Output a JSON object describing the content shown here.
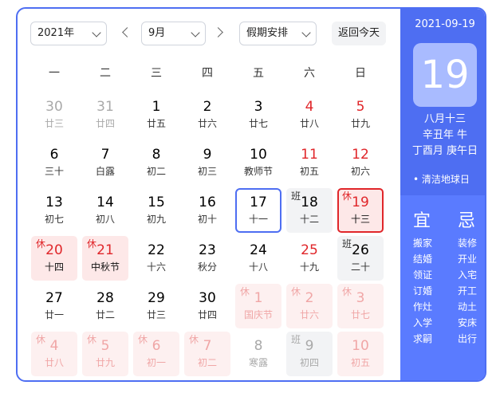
{
  "toolbar": {
    "year": "2021年",
    "month": "9月",
    "holiday_select": "假期安排",
    "today_button": "返回今天"
  },
  "weekdays": [
    "一",
    "二",
    "三",
    "四",
    "五",
    "六",
    "日"
  ],
  "days": [
    {
      "num": "30",
      "lunar": "廿三",
      "type": "other"
    },
    {
      "num": "31",
      "lunar": "廿四",
      "type": "other"
    },
    {
      "num": "1",
      "lunar": "廿五"
    },
    {
      "num": "2",
      "lunar": "廿六"
    },
    {
      "num": "3",
      "lunar": "廿七"
    },
    {
      "num": "4",
      "lunar": "廿八",
      "type": "weekend"
    },
    {
      "num": "5",
      "lunar": "廿九",
      "type": "weekend"
    },
    {
      "num": "6",
      "lunar": "三十"
    },
    {
      "num": "7",
      "lunar": "白露"
    },
    {
      "num": "8",
      "lunar": "初二"
    },
    {
      "num": "9",
      "lunar": "初三"
    },
    {
      "num": "10",
      "lunar": "教师节"
    },
    {
      "num": "11",
      "lunar": "初五",
      "type": "weekend"
    },
    {
      "num": "12",
      "lunar": "初六",
      "type": "weekend"
    },
    {
      "num": "13",
      "lunar": "初七"
    },
    {
      "num": "14",
      "lunar": "初八"
    },
    {
      "num": "15",
      "lunar": "初九"
    },
    {
      "num": "16",
      "lunar": "初十"
    },
    {
      "num": "17",
      "lunar": "十一",
      "type": "today"
    },
    {
      "num": "18",
      "lunar": "十二",
      "type": "work",
      "badge": "班"
    },
    {
      "num": "19",
      "lunar": "十三",
      "type": "holiday selected",
      "badge": "休"
    },
    {
      "num": "20",
      "lunar": "十四",
      "type": "holiday",
      "badge": "休"
    },
    {
      "num": "21",
      "lunar": "中秋节",
      "type": "holiday",
      "badge": "休"
    },
    {
      "num": "22",
      "lunar": "十六"
    },
    {
      "num": "23",
      "lunar": "秋分"
    },
    {
      "num": "24",
      "lunar": "十八"
    },
    {
      "num": "25",
      "lunar": "十九",
      "type": "weekend"
    },
    {
      "num": "26",
      "lunar": "二十",
      "type": "work",
      "badge": "班"
    },
    {
      "num": "27",
      "lunar": "廿一"
    },
    {
      "num": "28",
      "lunar": "廿二"
    },
    {
      "num": "29",
      "lunar": "廿三"
    },
    {
      "num": "30",
      "lunar": "廿四"
    },
    {
      "num": "1",
      "lunar": "国庆节",
      "type": "holiday faded",
      "badge": "休"
    },
    {
      "num": "2",
      "lunar": "廿六",
      "type": "holiday faded",
      "badge": "休"
    },
    {
      "num": "3",
      "lunar": "廿七",
      "type": "holiday faded",
      "badge": "休"
    },
    {
      "num": "4",
      "lunar": "廿八",
      "type": "holiday faded",
      "badge": "休"
    },
    {
      "num": "5",
      "lunar": "廿九",
      "type": "holiday faded",
      "badge": "休"
    },
    {
      "num": "6",
      "lunar": "初一",
      "type": "holiday faded",
      "badge": "休"
    },
    {
      "num": "7",
      "lunar": "初二",
      "type": "holiday faded",
      "badge": "休"
    },
    {
      "num": "8",
      "lunar": "寒露",
      "type": "other"
    },
    {
      "num": "9",
      "lunar": "初四",
      "type": "work faded",
      "badge": "班"
    },
    {
      "num": "10",
      "lunar": "初五",
      "type": "holiday faded"
    }
  ],
  "detail": {
    "date": "2021-09-19",
    "day": "19",
    "lunar_date": "八月十三",
    "year_gz": "辛丑年 牛",
    "month_day_gz": "丁酉月 庚午日",
    "festival": "• 清洁地球日",
    "yi_title": "宜",
    "ji_title": "忌",
    "yi": [
      "搬家",
      "结婚",
      "领证",
      "订婚",
      "作灶",
      "入学",
      "求嗣"
    ],
    "ji": [
      "装修",
      "开业",
      "入宅",
      "开工",
      "动土",
      "安床",
      "出行"
    ]
  },
  "colors": {
    "accent": "#4e6ef2",
    "holiday": "#e0262a"
  }
}
